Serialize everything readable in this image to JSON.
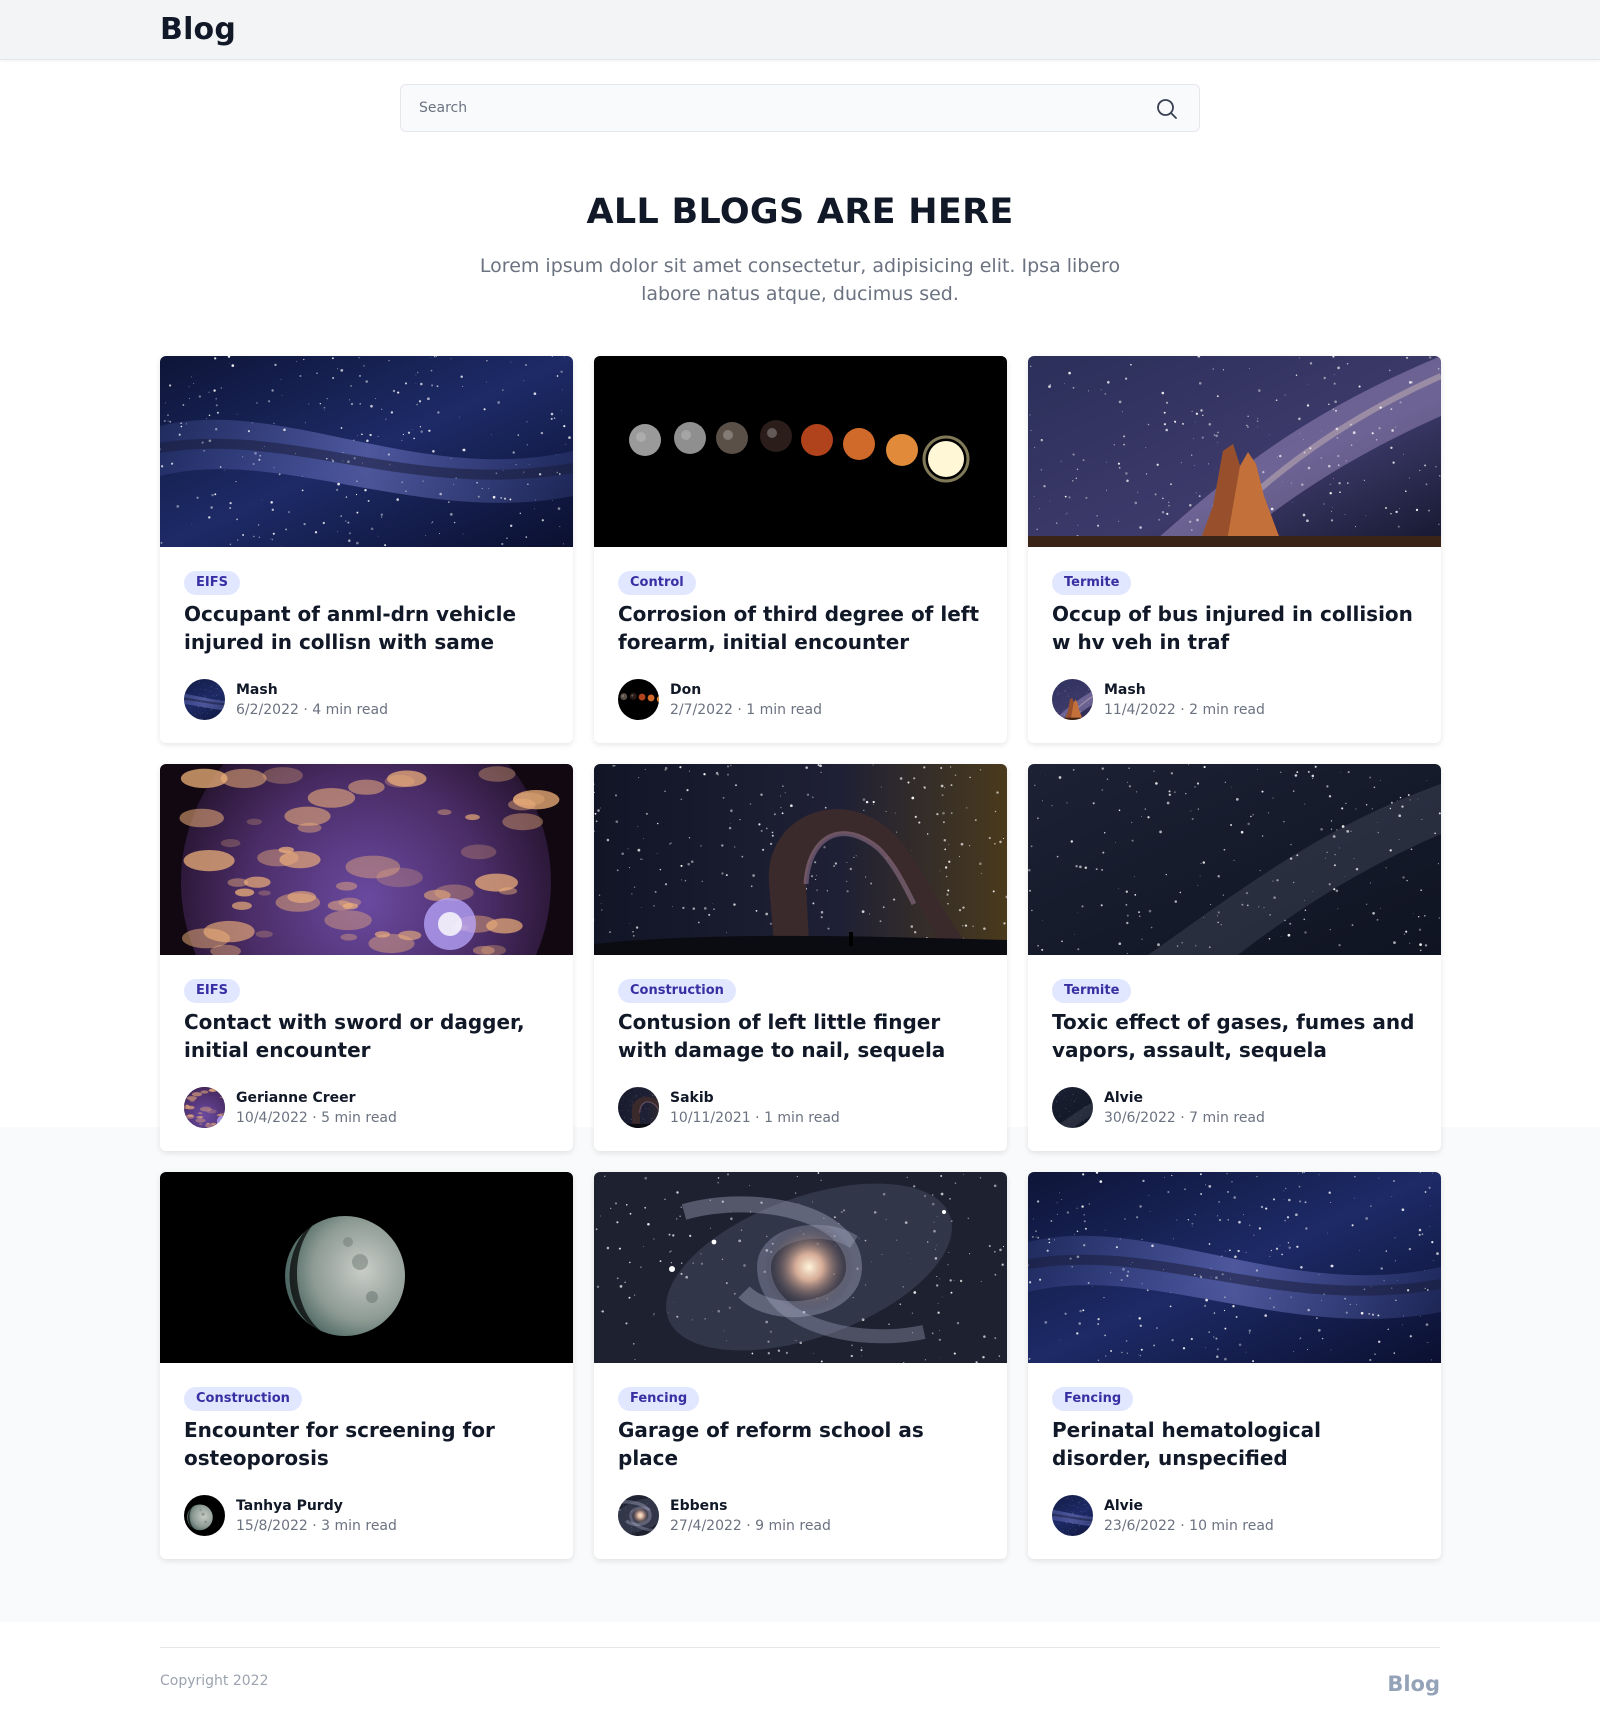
{
  "header": {
    "brand": "Blog"
  },
  "search": {
    "placeholder": "Search",
    "value": ""
  },
  "hero": {
    "title": "ALL BLOGS ARE HERE",
    "subtitle": "Lorem ipsum dolor sit amet consectetur, adipisicing elit. Ipsa libero labore natus atque, ducimus sed."
  },
  "posts": [
    {
      "tag": "EIFS",
      "title": "Occupant of anml-drn vehicle injured in collisn with same",
      "author": "Mash",
      "date": "6/2/2022",
      "read_time": "4 min read",
      "image": "milky-way-blue"
    },
    {
      "tag": "Control",
      "title": "Corrosion of third degree of left forearm, initial encounter",
      "author": "Don",
      "date": "2/7/2022",
      "read_time": "1 min read",
      "image": "lunar-eclipse-phases"
    },
    {
      "tag": "Termite",
      "title": "Occup of bus injured in collision w hv veh in traf",
      "author": "Mash",
      "date": "11/4/2022",
      "read_time": "2 min read",
      "image": "rock-under-milky-way"
    },
    {
      "tag": "EIFS",
      "title": "Contact with sword or dagger, initial encounter",
      "author": "Gerianne Creer",
      "date": "10/4/2022",
      "read_time": "5 min read",
      "image": "sun-surface"
    },
    {
      "tag": "Construction",
      "title": "Contusion of left little finger with damage to nail, sequela",
      "author": "Sakib",
      "date": "10/11/2021",
      "read_time": "1 min read",
      "image": "arch-night-sky"
    },
    {
      "tag": "Termite",
      "title": "Toxic effect of gases, fumes and vapors, assault, sequela",
      "author": "Alvie",
      "date": "30/6/2022",
      "read_time": "7 min read",
      "image": "dark-starfield"
    },
    {
      "tag": "Construction",
      "title": "Encounter for screening for osteoporosis",
      "author": "Tanhya Purdy",
      "date": "15/8/2022",
      "read_time": "3 min read",
      "image": "moon"
    },
    {
      "tag": "Fencing",
      "title": "Garage of reform school as place",
      "author": "Ebbens",
      "date": "27/4/2022",
      "read_time": "9 min read",
      "image": "spiral-galaxy"
    },
    {
      "tag": "Fencing",
      "title": "Perinatal hematological disorder, unspecified",
      "author": "Alvie",
      "date": "23/6/2022",
      "read_time": "10 min read",
      "image": "milky-way-blue"
    }
  ],
  "footer": {
    "copyright": "Copyright 2022",
    "brand": "Blog"
  },
  "colors": {
    "tag_bg": "#e0e7ff",
    "tag_text": "#3730a3",
    "header_bg": "#f3f4f6",
    "muted_text": "#6b7280"
  }
}
